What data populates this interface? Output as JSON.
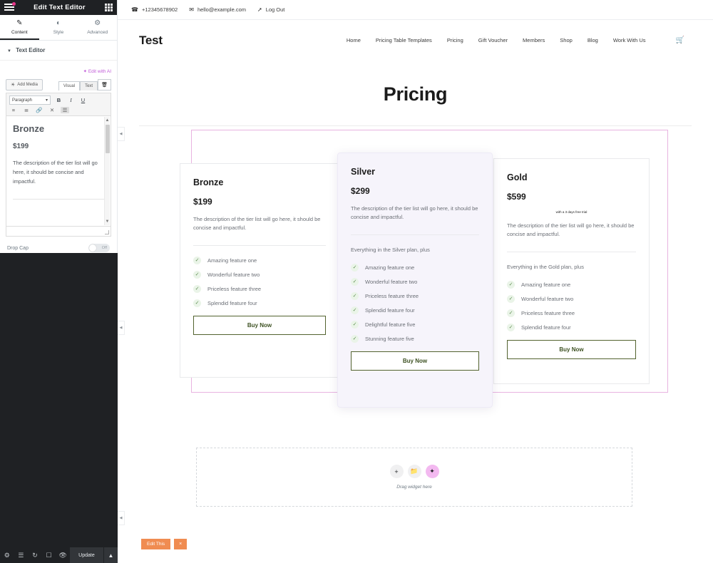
{
  "panel": {
    "header": {
      "title": "Edit Text Editor",
      "menu_icon": "hamburger-icon",
      "apps_icon": "grid-icon"
    },
    "tabs": [
      {
        "label": "Content",
        "icon": "pencil-icon",
        "active": true
      },
      {
        "label": "Style",
        "icon": "contrast-icon",
        "active": false
      },
      {
        "label": "Advanced",
        "icon": "gear-icon",
        "active": false
      }
    ],
    "section_title": "Text Editor",
    "ai_link": "Edit with AI",
    "editor": {
      "add_media": "Add Media",
      "tab_visual": "Visual",
      "tab_text": "Text",
      "trash_icon": "trash-icon",
      "format_select": "Paragraph",
      "bold": "B",
      "italic": "I",
      "underline": "U",
      "bullet_list_icon": "bullet-list-icon",
      "numbered_list_icon": "numbered-list-icon",
      "link_icon": "link-icon",
      "readmore_icon": "read-more-icon",
      "toolbar_toggle_icon": "toolbar-toggle-icon",
      "content": {
        "heading": "Bronze",
        "price": "$199",
        "description": "The description of the tier list will go here, it should be concise and impactful."
      }
    },
    "drop_cap": {
      "label": "Drop Cap",
      "state": "Off"
    },
    "footer": {
      "settings_icon": "gear-icon",
      "navigator_icon": "layers-icon",
      "history_icon": "history-icon",
      "responsive_icon": "responsive-icon",
      "preview_icon": "eye-icon",
      "update_label": "Update",
      "caret_icon": "chevron-up-icon"
    }
  },
  "site": {
    "topbar": {
      "phone": "+12345678902",
      "phone_icon": "phone-icon",
      "email": "hello@example.com",
      "email_icon": "envelope-icon",
      "logout": "Log Out",
      "logout_icon": "logout-icon"
    },
    "logo": "Test",
    "nav": [
      "Home",
      "Pricing Table Templates",
      "Pricing",
      "Gift Voucher",
      "Members",
      "Shop",
      "Blog",
      "Work With Us"
    ],
    "cart_icon": "shopping-cart-icon",
    "page_title": "Pricing"
  },
  "cards": [
    {
      "id": "bronze",
      "name": "Bronze",
      "price": "$199",
      "trial": "",
      "description": "The description of the tier list will go here, it should be concise and impactful.",
      "plus_line": "",
      "features": [
        "Amazing feature one",
        "Wonderful feature two",
        "Priceless feature three",
        "Splendid feature four"
      ],
      "cta": "Buy Now"
    },
    {
      "id": "silver",
      "name": "Silver",
      "price": "$299",
      "trial": "",
      "description": "The description of the tier list will go here, it should be concise and impactful.",
      "plus_line": "Everything in the Silver plan, plus",
      "features": [
        "Amazing feature one",
        "Wonderful feature two",
        "Priceless feature three",
        "Splendid feature four",
        "Delightful feature five",
        "Stunning feature five"
      ],
      "cta": "Buy Now"
    },
    {
      "id": "gold",
      "name": "Gold",
      "price": "$599",
      "trial": "with a 3 days free trial",
      "description": "The description of the tier list will go here, it should be concise and impactful.",
      "plus_line": "Everything in the Gold plan, plus",
      "features": [
        "Amazing feature one",
        "Wonderful feature two",
        "Priceless feature three",
        "Splendid feature four"
      ],
      "cta": "Buy Now"
    }
  ],
  "dropzone": {
    "add_icon": "plus-icon",
    "folder_icon": "folder-icon",
    "ai_icon": "sparkle-ai-icon",
    "text": "Drag widget here"
  },
  "edit_bar": {
    "edit_label": "Edit This",
    "close_label": "×"
  },
  "colors": {
    "panel_dark": "#1f2124",
    "accent_pink": "#e6368a",
    "ai_purple": "#c05bd8",
    "selection_outline": "#e8b3e0",
    "buy_border": "#53632f",
    "check_green": "#5b8c4d",
    "orange": "#f08c51",
    "silver_bg": "#f6f4fb"
  }
}
